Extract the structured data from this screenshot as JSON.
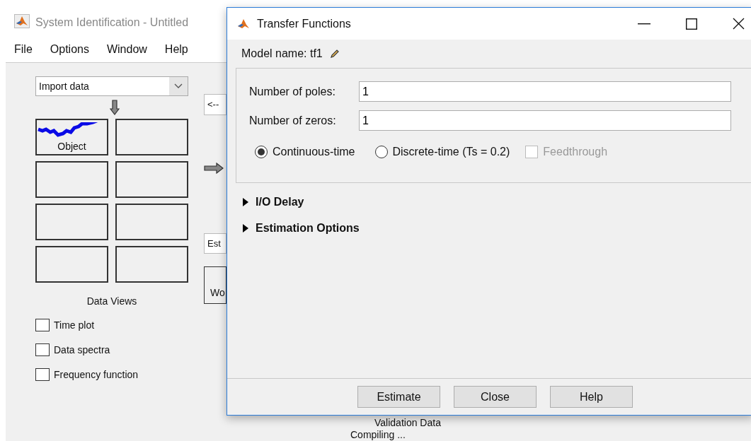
{
  "background_window": {
    "title": "System Identification - Untitled",
    "menu": [
      "File",
      "Options",
      "Window",
      "Help"
    ],
    "import_dropdown": {
      "value": "Import data"
    },
    "data_tiles": [
      {
        "kind": "signal",
        "label": "Object"
      },
      {
        "kind": "empty"
      },
      {
        "kind": "empty"
      },
      {
        "kind": "empty"
      },
      {
        "kind": "empty"
      },
      {
        "kind": "empty"
      },
      {
        "kind": "empty"
      },
      {
        "kind": "empty"
      }
    ],
    "data_views": {
      "title": "Data Views",
      "options": [
        {
          "label": "Time plot",
          "checked": false
        },
        {
          "label": "Data spectra",
          "checked": false
        },
        {
          "label": "Frequency function",
          "checked": false
        }
      ]
    },
    "partial_controls": {
      "arrow_button": "<--",
      "estimate_menu": "Est",
      "working_data": "Wo"
    },
    "validation_label": "Validation Data",
    "status": "Compiling ..."
  },
  "dialog": {
    "title": "Transfer Functions",
    "model_name": "Model name: tf1",
    "fields": [
      {
        "label": "Number of poles:",
        "value": "1"
      },
      {
        "label": "Number of zeros:",
        "value": "1"
      }
    ],
    "time_domain": [
      {
        "label": "Continuous-time",
        "selected": true
      },
      {
        "label": "Discrete-time (Ts = 0.2)",
        "selected": false
      }
    ],
    "feedthrough": {
      "label": "Feedthrough",
      "checked": false,
      "disabled": true
    },
    "sections": [
      {
        "label": "I/O Delay",
        "expanded": false
      },
      {
        "label": "Estimation Options",
        "expanded": false
      }
    ],
    "buttons": [
      "Estimate",
      "Close",
      "Help"
    ]
  }
}
